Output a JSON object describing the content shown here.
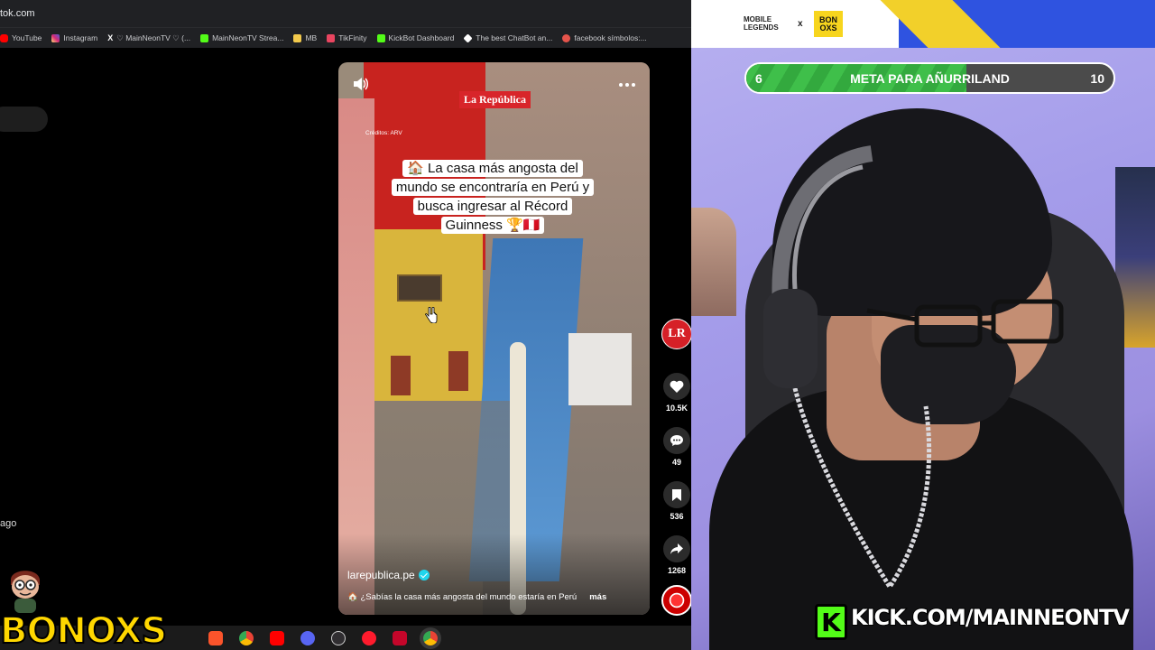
{
  "browser": {
    "url": "tok.com",
    "bookmarks": [
      {
        "label": "YouTube",
        "icon": "youtube-icon",
        "color": "#ff0000"
      },
      {
        "label": "Instagram",
        "icon": "instagram-icon",
        "color": "#d62976"
      },
      {
        "label": "♡ MainNeonTV ♡ (...",
        "icon": "x-icon",
        "color": "#ffffff"
      },
      {
        "label": "MainNeonTV Strea...",
        "icon": "kick-icon",
        "color": "#53fc18"
      },
      {
        "label": "MB",
        "icon": "folder-icon",
        "color": "#f2c94c"
      },
      {
        "label": "TikFinity",
        "icon": "tikfinity-icon",
        "color": "#e94560"
      },
      {
        "label": "KickBot Dashboard",
        "icon": "kickbot-icon",
        "color": "#53fc18"
      },
      {
        "label": "The best ChatBot an...",
        "icon": "chatbot-icon",
        "color": "#ffffff"
      },
      {
        "label": "facebook símbolos:...",
        "icon": "globe-icon",
        "color": "#e5544b"
      }
    ],
    "left_text": "ago"
  },
  "tiktok": {
    "brand": "La República",
    "credits": "Créditos: ARV",
    "caption": "🏠 La casa más angosta del mundo se encontraría en Perú y busca ingresar al Récord Guinness 🏆🇵🇪",
    "author": "larepublica.pe",
    "description": "🏠 ¿Sabías la casa más angosta del mundo estaría en Perú",
    "more_label": "más",
    "profile_label": "LR",
    "likes": "10.5K",
    "comments": "49",
    "saves": "536",
    "shares": "1268"
  },
  "overlay": {
    "sponsor_text": "BONOXS",
    "header": {
      "logo_text": "MOBILE LEGENDS",
      "separator": "x",
      "partner_logo": "BON OXS"
    },
    "goal": {
      "current": "6",
      "title": "META PARA AÑURRILAND",
      "target": "10",
      "progress_fraction": 0.6
    },
    "kick": {
      "logo": "K",
      "url": "KICK.COM/MAINNEONTV"
    }
  },
  "colors": {
    "kick_green": "#53fc18",
    "goal_green": "#3fbf4a",
    "tiktok_red": "#d8252a",
    "stream_bg": "#a49cea"
  }
}
